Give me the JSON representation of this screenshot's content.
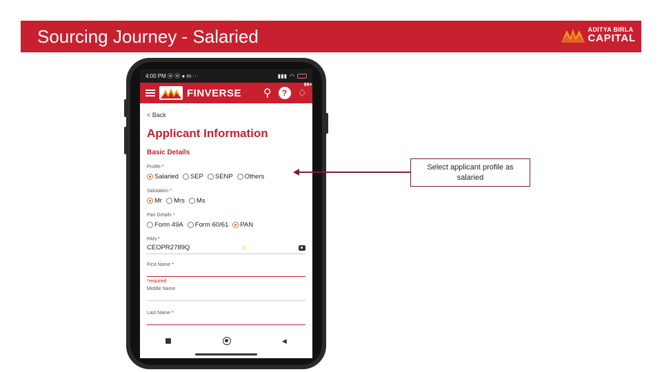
{
  "slide": {
    "title": "Sourcing Journey - Salaried",
    "brand": {
      "line1": "ADITYA BIRLA",
      "line2": "CAPITAL"
    },
    "brand_color": "#c8202f"
  },
  "phone": {
    "status_bar": {
      "time": "4:00 PM",
      "indicators": "ⓦ ⓦ ● m ···"
    },
    "app_bar": {
      "title": "FINVERSE",
      "notification_badge": "99+"
    },
    "form": {
      "back": "< Back",
      "heading": "Applicant Information",
      "section": "Basic Details",
      "profile": {
        "label": "Profile",
        "options": [
          "Salaried",
          "SEP",
          "SENP",
          "Others"
        ],
        "selected": "Salaried"
      },
      "salutation": {
        "label": "Salutation",
        "options": [
          "Mr",
          "Mrs",
          "Ms"
        ],
        "selected": "Mr"
      },
      "pan_details": {
        "label": "Pan Details",
        "options": [
          "Form 49A",
          "Form 60/61",
          "PAN"
        ],
        "selected": "PAN"
      },
      "pan": {
        "label": "PAN",
        "value": "CEOPR2789Q"
      },
      "first_name": {
        "label": "First Name",
        "value": "",
        "error": "*required"
      },
      "middle_name": {
        "label": "Middle Name",
        "value": ""
      },
      "last_name": {
        "label": "Last Name",
        "value": ""
      },
      "required_marker": "*"
    }
  },
  "callout": {
    "text_line1": "Select applicant profile as",
    "text_line2": "salaried"
  }
}
